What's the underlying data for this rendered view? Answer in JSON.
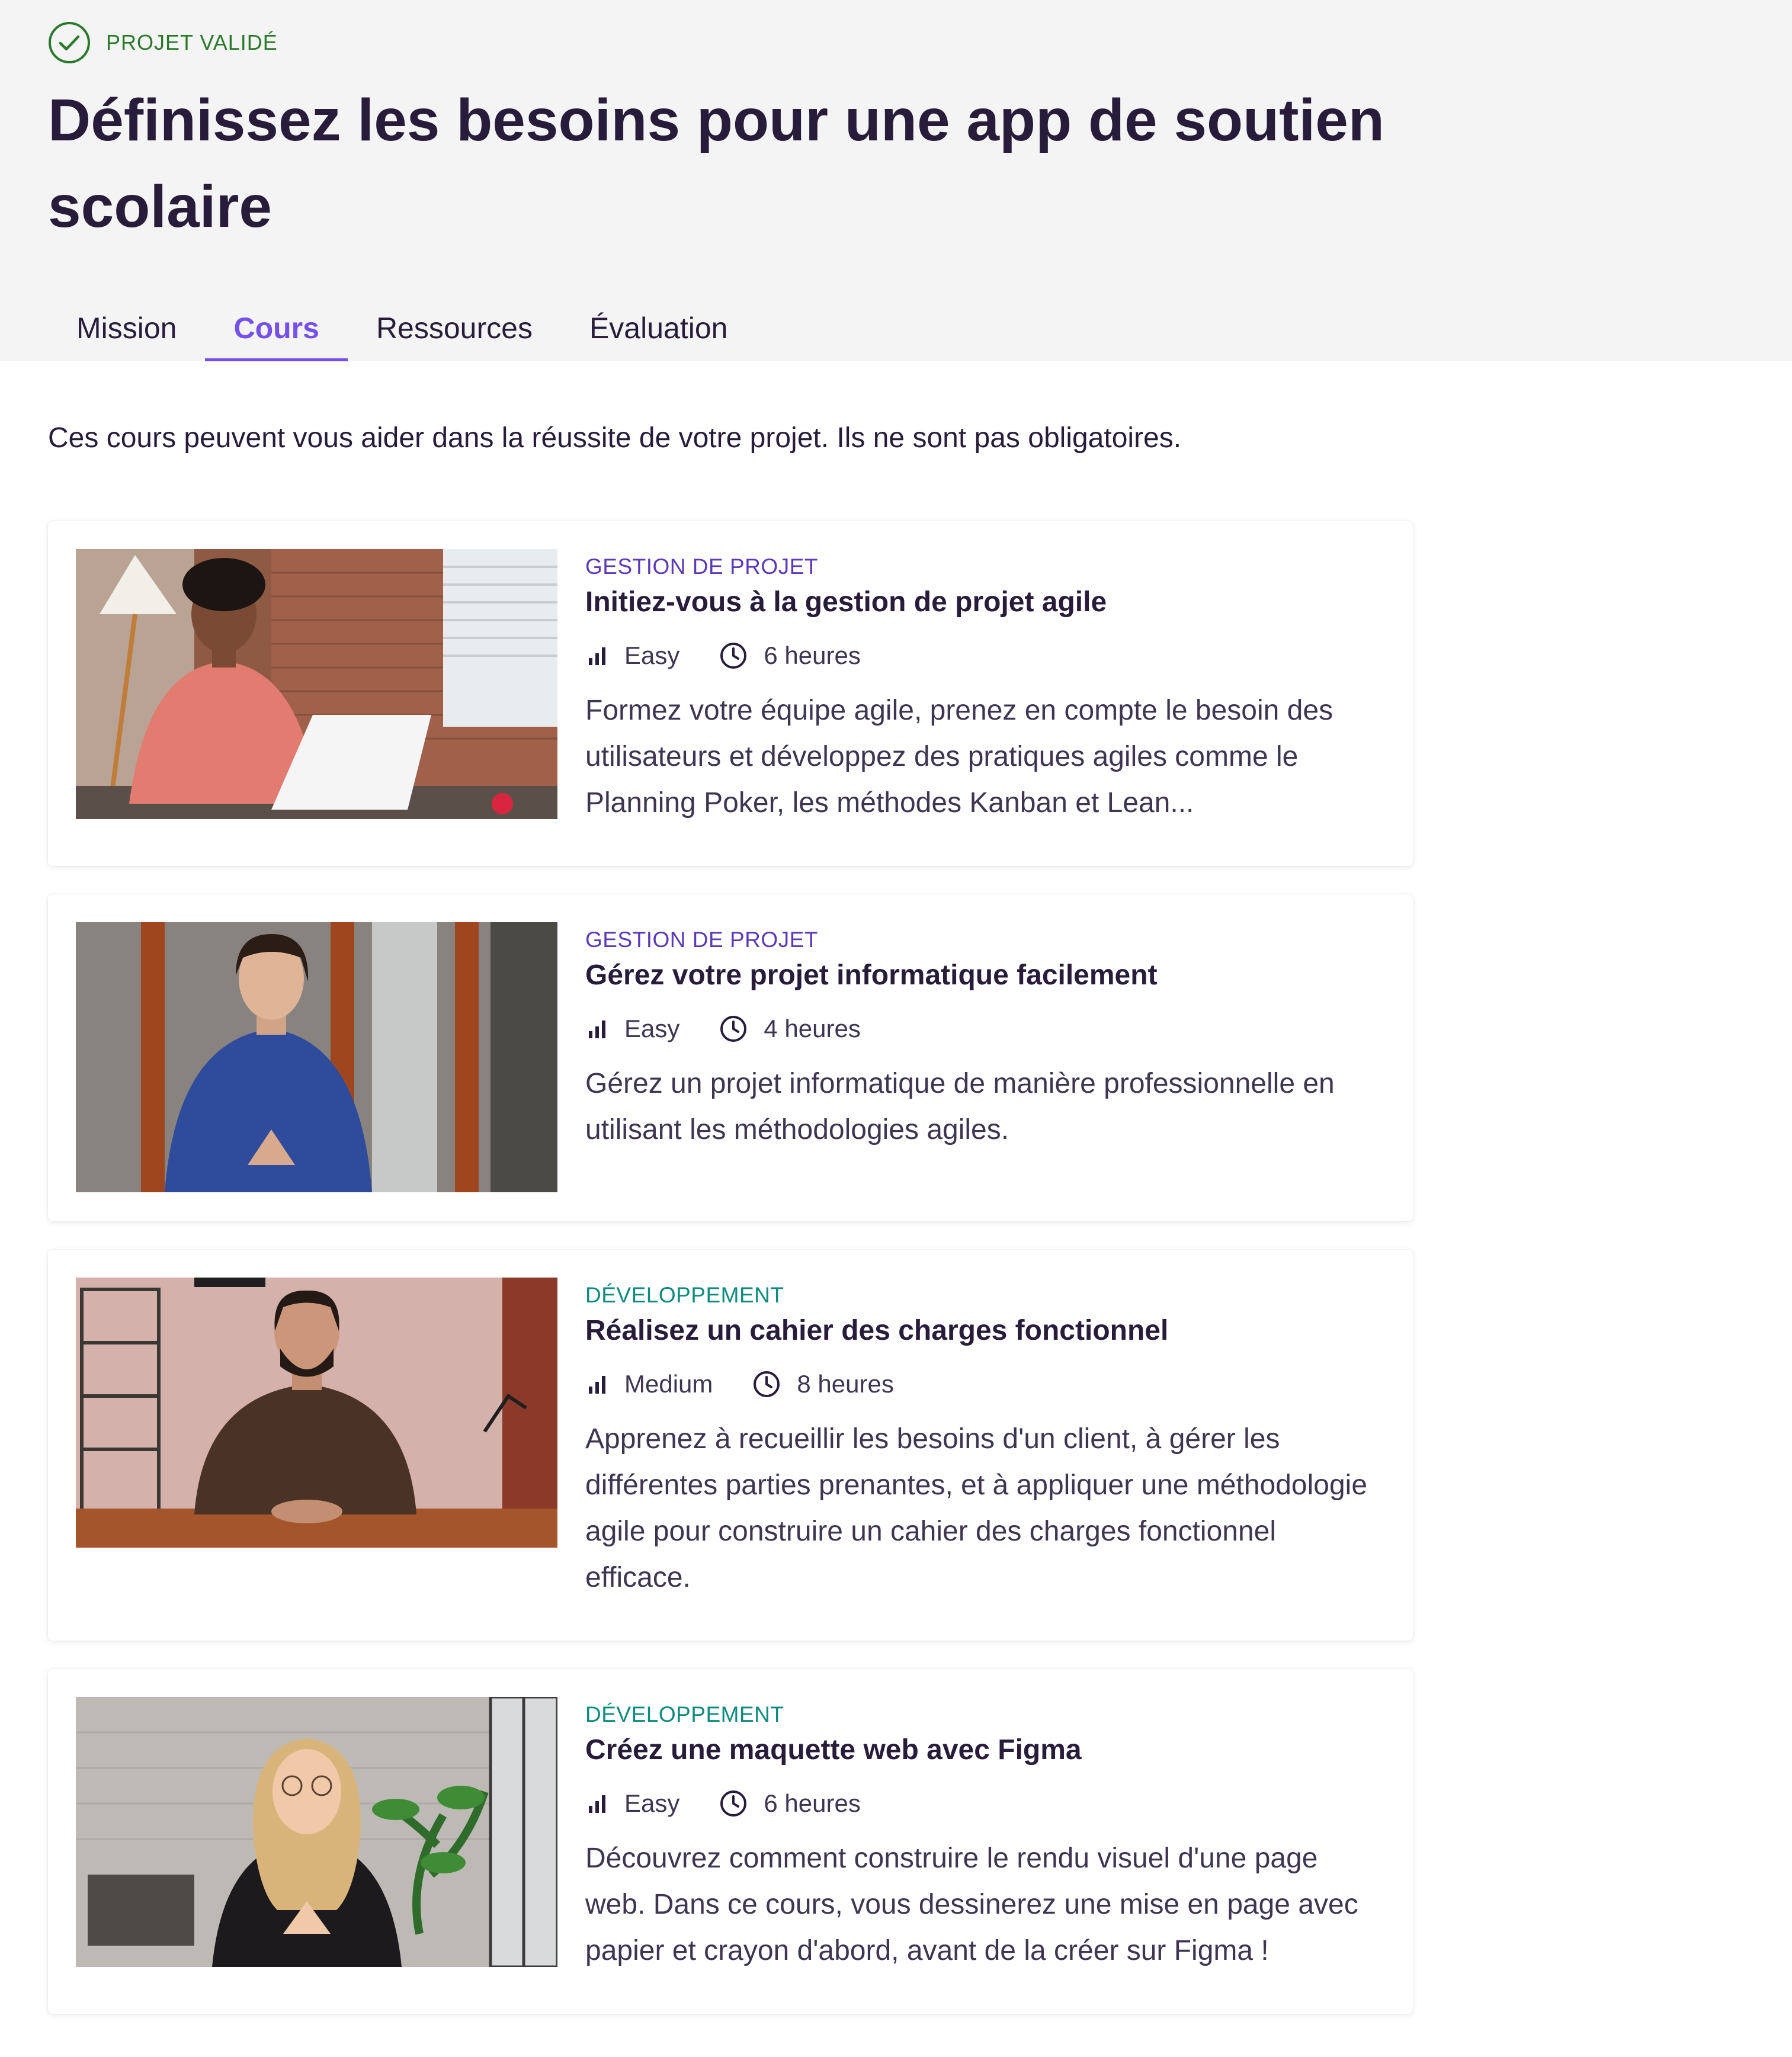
{
  "header": {
    "status_label": "PROJET VALIDÉ",
    "status_icon": "check-circle-icon",
    "title": "Définissez les besoins pour une app de soutien scolaire"
  },
  "tabs": [
    {
      "label": "Mission",
      "active": false
    },
    {
      "label": "Cours",
      "active": true
    },
    {
      "label": "Ressources",
      "active": false
    },
    {
      "label": "Évaluation",
      "active": false
    }
  ],
  "intro": "Ces cours peuvent vous aider dans la réussite de votre projet. Ils ne sont pas obligatoires.",
  "colors": {
    "accent": "#7451eb",
    "success": "#2b7a2b",
    "category_project": "#5b3ab7",
    "category_dev": "#0e8a7e",
    "text": "#271d3b"
  },
  "courses": [
    {
      "category": "GESTION DE PROJET",
      "title": "Initiez-vous à la gestion de projet agile",
      "level": "Easy",
      "duration": "6 heures",
      "description": "Formez votre équipe agile, prenez en compte le besoin des utilisateurs et développez des pratiques agiles comme le Planning Poker, les méthodes Kanban et Lean..."
    },
    {
      "category": "GESTION DE PROJET",
      "title": "Gérez votre projet informatique facilement",
      "level": "Easy",
      "duration": "4 heures",
      "description": "Gérez un projet informatique de manière professionnelle en utilisant les méthodologies agiles."
    },
    {
      "category": "DÉVELOPPEMENT",
      "title": "Réalisez un cahier des charges fonctionnel",
      "level": "Medium",
      "duration": "8 heures",
      "description": "Apprenez à recueillir les besoins d'un client, à gérer les différentes parties prenantes, et à appliquer une méthodologie agile pour construire un cahier des charges fonctionnel efficace."
    },
    {
      "category": "DÉVELOPPEMENT",
      "title": "Créez une maquette web avec Figma",
      "level": "Easy",
      "duration": "6 heures",
      "description": "Découvrez comment construire le rendu visuel d'une page web. Dans ce cours, vous dessinerez une mise en page avec papier et crayon d'abord, avant de la créer sur Figma !"
    }
  ]
}
